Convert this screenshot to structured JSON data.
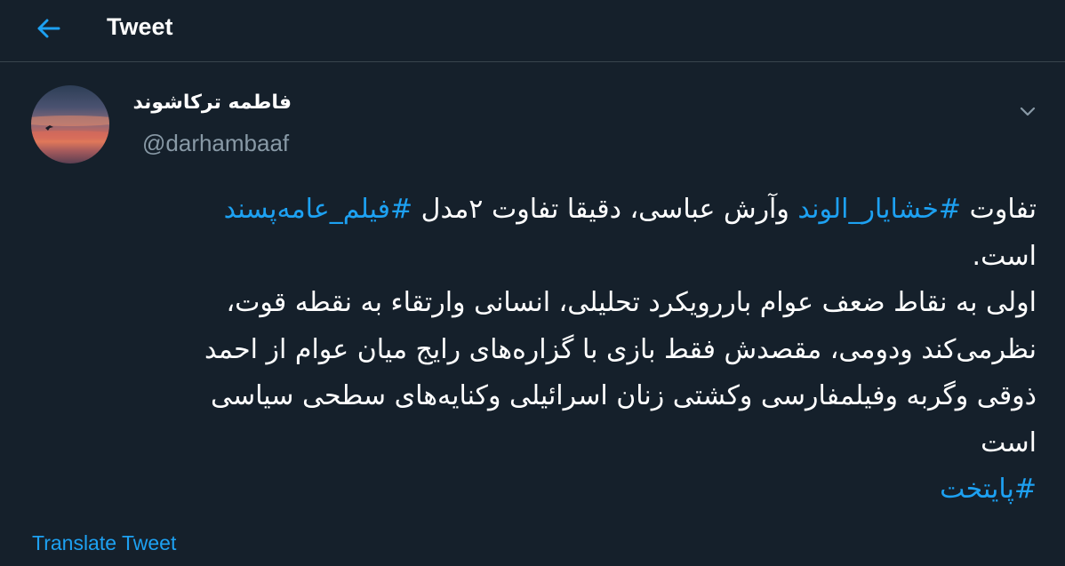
{
  "header": {
    "title": "Tweet",
    "back_icon": "back-arrow-icon"
  },
  "tweet": {
    "author_name": "فاطمه ترکاشوند",
    "handle": "@darhambaaf",
    "menu_icon": "chevron-down-icon",
    "line1": {
      "text1": "تفاوت ",
      "hashtag1": "#خشایار_الوند",
      "text2": " وآرش عباسی، دقیقا تفاوت ۲مدل ",
      "hashtag2": "#فیلم_عامه‌پسند"
    },
    "line2": "است.",
    "line3": "اولی به نقاط ضعف عوام باررویکرد تحلیلی، انسانی وارتقاء به نقطه قوت،",
    "line4": "نظرمی‌کند ودومی، مقصدش فقط بازی با گزاره‌های رایج میان عوام از احمد",
    "line5": "ذوقی وگربه وفیلمفارسی وکشتی زنان اسرائیلی وکنایه‌های سطحی سیاسی",
    "line6": "است",
    "hashtag_final": "#پایتخت"
  },
  "translate_label": "Translate Tweet",
  "colors": {
    "background": "#15202b",
    "accent": "#1da1f2",
    "secondary_text": "#8899a6",
    "divider": "#38444d"
  }
}
